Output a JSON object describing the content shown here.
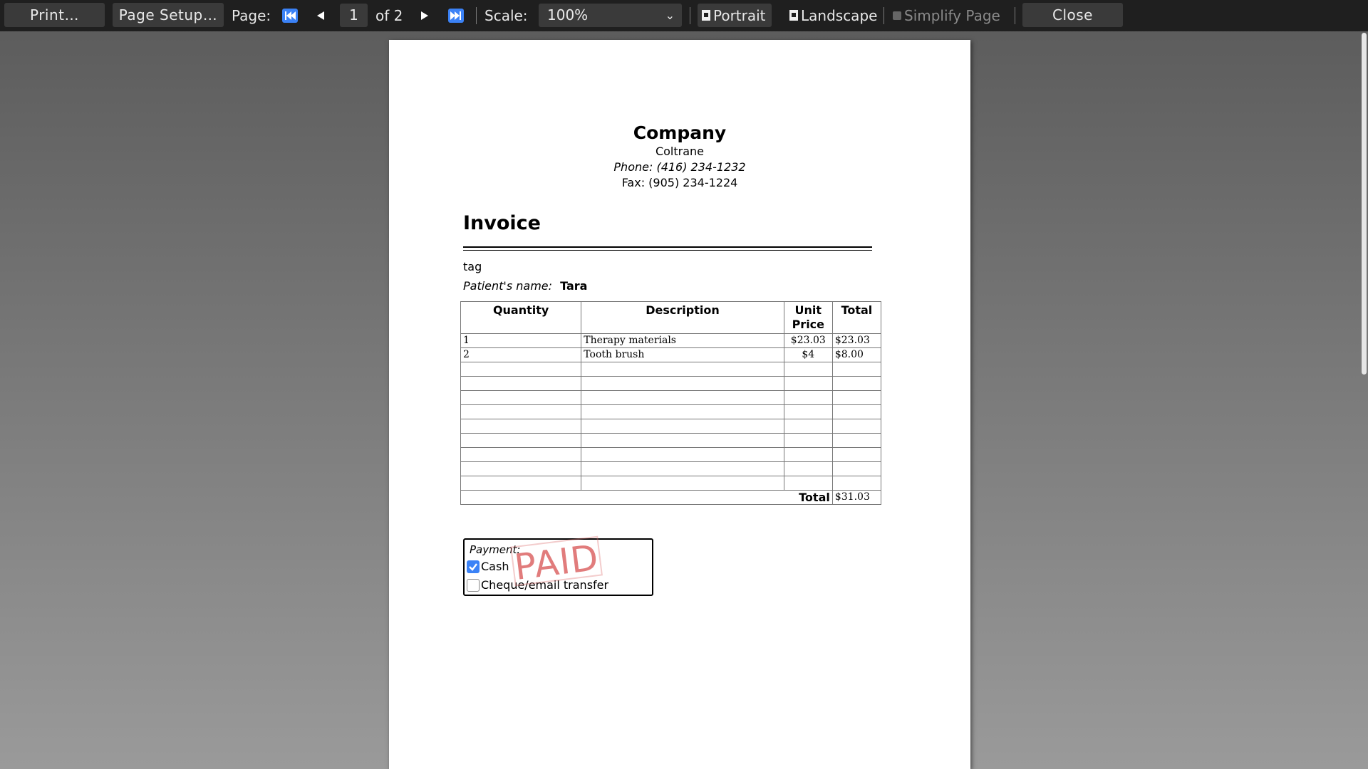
{
  "toolbar": {
    "print_label": "Print…",
    "page_setup_label": "Page Setup…",
    "page_label": "Page:",
    "current_page": "1",
    "of_pages": "of 2",
    "scale_label": "Scale:",
    "scale_value": "100%",
    "portrait_label": "Portrait",
    "landscape_label": "Landscape",
    "simplify_label": "Simplify Page",
    "close_label": "Close",
    "icons": {
      "first": "first-page-icon",
      "prev": "previous-page-icon",
      "next": "next-page-icon",
      "last": "last-page-icon"
    }
  },
  "document": {
    "company": {
      "name": "Company",
      "line1": "Coltrane",
      "phone": "Phone: (416) 234-1232",
      "fax": "Fax: (905) 234-1224"
    },
    "title": "Invoice",
    "tag": "tag",
    "patient_label": "Patient's name:",
    "patient_name": "Tara",
    "table": {
      "headers": [
        "Quantity",
        "Description",
        "Unit Price",
        "Total"
      ],
      "rows": [
        {
          "qty": "1",
          "desc": "Therapy materials",
          "unit": "$23.03",
          "total": "$23.03"
        },
        {
          "qty": "2",
          "desc": "Tooth brush",
          "unit": "$4",
          "total": "$8.00"
        }
      ],
      "empty_rows": 9,
      "total_label": "Total",
      "total_value": "$31.03"
    },
    "payment": {
      "title": "Payment:",
      "options": [
        {
          "label": "Cash",
          "checked": true
        },
        {
          "label": "Cheque/email transfer",
          "checked": false
        }
      ],
      "stamp": "PAID"
    }
  },
  "colors": {
    "toolbar_bg": "#1f1f1f",
    "button_bg": "#3a3a3a",
    "checkbox_accent": "#3b82f6",
    "stamp": "#d75050"
  }
}
